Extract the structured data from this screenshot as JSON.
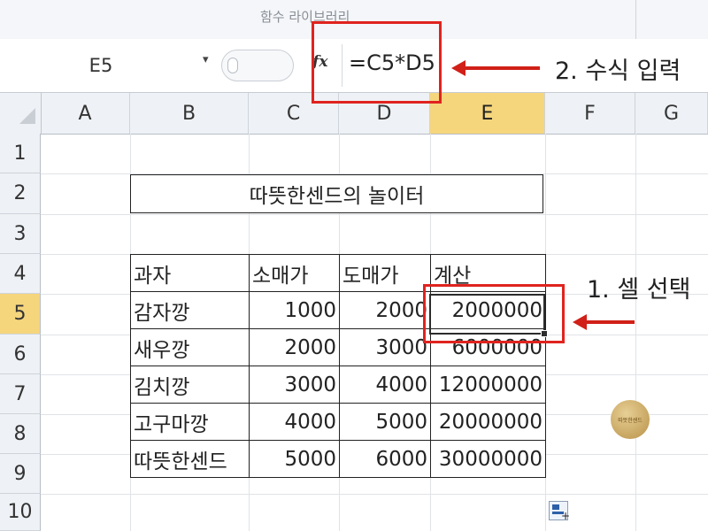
{
  "ribbon": {
    "group_label": "함수 라이브러리"
  },
  "formula_bar": {
    "name_box": "E5",
    "name_box_dropdown": "▾",
    "fx_label": "fx",
    "formula": "=C5*D5"
  },
  "annotations": {
    "step2": "2. 수식 입력",
    "step1": "1. 셀 선택",
    "accent_color": "#e0231f"
  },
  "columns": [
    "A",
    "B",
    "C",
    "D",
    "E",
    "F",
    "G"
  ],
  "selected_column": "E",
  "rows": [
    "1",
    "2",
    "3",
    "4",
    "5",
    "6",
    "7",
    "8",
    "9",
    "10"
  ],
  "selected_row": "5",
  "sheet": {
    "title": "따뜻한센드의 놀이터",
    "headers": [
      "과자",
      "소매가",
      "도매가",
      "계산"
    ],
    "data": [
      [
        "감자깡",
        "1000",
        "2000",
        "2000000"
      ],
      [
        "새우깡",
        "2000",
        "3000",
        "6000000"
      ],
      [
        "김치깡",
        "3000",
        "4000",
        "12000000"
      ],
      [
        "고구마깡",
        "4000",
        "5000",
        "20000000"
      ],
      [
        "따뜻한센드",
        "5000",
        "6000",
        "30000000"
      ]
    ]
  },
  "logo_text": "따뜻한센드",
  "autofill_icon": "autofill-options-icon"
}
